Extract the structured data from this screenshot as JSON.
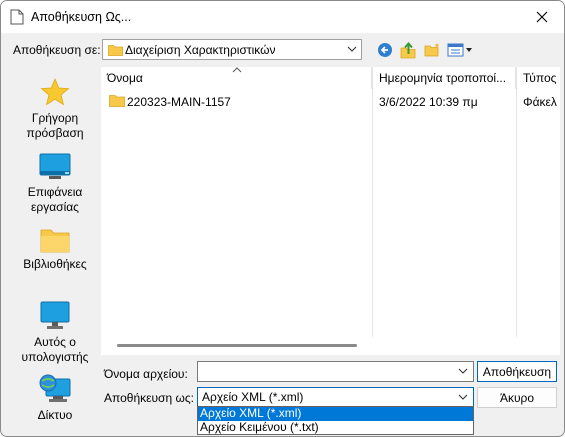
{
  "window": {
    "title": "Αποθήκευση Ως..."
  },
  "save_in": {
    "label": "Αποθήκευση σε:",
    "value": "Διαχείριση Χαρακτηριστικών"
  },
  "toolbar": {
    "icons": [
      "back-icon",
      "up-folder-icon",
      "new-folder-icon",
      "view-menu-icon"
    ]
  },
  "places": [
    {
      "label": "Γρήγορη πρόσβαση",
      "icon": "star-icon"
    },
    {
      "label": "Επιφάνεια εργασίας",
      "icon": "desktop-icon"
    },
    {
      "label": "Βιβλιοθήκες",
      "icon": "folder-icon"
    },
    {
      "label": "Αυτός ο υπολογιστής",
      "icon": "computer-icon"
    },
    {
      "label": "Δίκτυο",
      "icon": "network-icon"
    }
  ],
  "columns": {
    "name": "Όνομα",
    "modified": "Ημερομηνία τροποποί...",
    "type": "Τύπος"
  },
  "files": [
    {
      "name": "220323-MAIN-1157",
      "modified": "3/6/2022 10:39 πμ",
      "type": "Φάκελ"
    }
  ],
  "filename": {
    "label": "Όνομα αρχείου:",
    "value": ""
  },
  "save_as_type": {
    "label": "Αποθήκευση ως:",
    "value": "Αρχείο XML (*.xml)",
    "options": [
      "Αρχείο XML (*.xml)",
      "Αρχείο Κειμένου (*.txt)"
    ]
  },
  "buttons": {
    "save": "Αποθήκευση",
    "cancel": "Άκυρο"
  },
  "colors": {
    "accent": "#0067c0",
    "selection": "#0078d7",
    "folder": "#f8c84a"
  }
}
